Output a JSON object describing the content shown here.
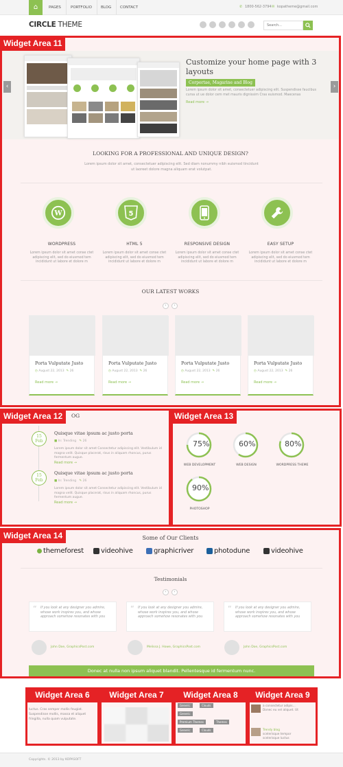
{
  "nav": {
    "items": [
      "PAGES",
      "PORTFOLIO",
      "BLOG",
      "CONTACT"
    ],
    "phone": "1800-562-3794",
    "email": "kopatheme@gmail.com"
  },
  "logo": {
    "bold": "CIRCLE",
    "light": "THEME"
  },
  "search": {
    "placeholder": "Search..."
  },
  "widget_areas": {
    "wa11": "Widget Area 11",
    "wa12": "Widget Area 12",
    "wa13": "Widget Area 13",
    "wa14": "Widget Area 14",
    "wa6": "Widget Area 6",
    "wa7": "Widget Area 7",
    "wa8": "Widget Area 8",
    "wa9": "Widget Area 9"
  },
  "slider": {
    "title": "Customize your home page with 3 layouts",
    "highlight": "Corportae, Magarine and Blog",
    "text": "Lorem ipsum dolor sit amet, consectetuer adipiscing elit. Suspendisse faucibus cursa ut ue dolor cem met mauris dignissim Cras euismod. Maecenas",
    "more": "Read more →"
  },
  "intro": {
    "title": "LOOKING FOR A PROFESSIONAL AND UNIQUE DESIGN?",
    "text": "Lorem ipsum dolor sit amet, consectetuer adipiscing elit. Sed diam nonummy nibh euismod tincidunt ut laoreet dolore magna aliquam erat volutpat."
  },
  "features": [
    {
      "title": "WORDPRESS",
      "icon": "wordpress-icon",
      "text": "Lorem ipsum dolor sit amet conse ctet adipiscing elit, sed do eiusmod tem incididunt ut labore et dolore m"
    },
    {
      "title": "HTML 5",
      "icon": "html5-icon",
      "text": "Lorem ipsum dolor sit amet conse ctet adipiscing elit, sed do eiusmod tem incididunt ut labore et dolore m"
    },
    {
      "title": "RESPONSIVE DESIGN",
      "icon": "mobile-icon",
      "text": "Lorem ipsum dolor sit amet conse ctet adipiscing elit, sed do eiusmod tem incididunt ut labore et dolore m"
    },
    {
      "title": "EASY SETUP",
      "icon": "wrench-icon",
      "text": "Lorem ipsum dolor sit amet conse ctet adipiscing elit, sed do eiusmod tem incididunt ut labore et dolore m"
    }
  ],
  "works": {
    "title": "OUR LATEST WORKS",
    "items": [
      {
        "title": "Porta Vulputate Justo",
        "date": "August 22, 2013",
        "comments": "26",
        "more": "Read more →"
      },
      {
        "title": "Porta Vulputate Justo",
        "date": "August 22, 2013",
        "comments": "26",
        "more": "Read more →"
      },
      {
        "title": "Porta Vulputate Justo",
        "date": "August 22, 2013",
        "comments": "26",
        "more": "Read more →"
      },
      {
        "title": "Porta Vulputate Justo",
        "date": "August 22, 2013",
        "comments": "26",
        "more": "Read more →"
      }
    ]
  },
  "blog": {
    "heading_tail": "OG",
    "posts": [
      {
        "day": "15",
        "month": "Feb",
        "title": "Quisque vitae ipsum ac justo porta",
        "category": "In: Trending",
        "comments": "26",
        "text": "Lorem ipsum dolor sit amet Consectetur adipiscing elit. Vestibulum id magna velit. Quisque placerat, risus in aliquam rhoncus, purus fermentum augue.",
        "more": "Read more →"
      },
      {
        "day": "15",
        "month": "Feb",
        "title": "Quisque vitae ipsum ac justo porta",
        "category": "In: Trending",
        "comments": "26",
        "text": "Lorem ipsum dolor sit amet Consectetur adipiscing elit. Vestibulum id magna velit. Quisque placerat, risus in aliquam rhoncus, purus fermentum augue.",
        "more": "Read more →"
      }
    ]
  },
  "skills": [
    {
      "value": "75%",
      "percent": 75,
      "label": "WEB DEVELOPMENT"
    },
    {
      "value": "60%",
      "percent": 60,
      "label": "WEB DESIGN"
    },
    {
      "value": "80%",
      "percent": 80,
      "label": "WORDPRESS THEME"
    },
    {
      "value": "90%",
      "percent": 90,
      "label": "PHOTOSHOP"
    }
  ],
  "clients": {
    "title": "Some of Our Clients",
    "names": [
      "themeforest",
      "videohive",
      "graphicriver",
      "photodune",
      "videohive"
    ]
  },
  "testimonials": {
    "title": "Testimonials",
    "items": [
      {
        "quote": "If you look at any designer you admire, whose work inspires you, and whose approach somehow resonates with you",
        "name": "John Doe, GraphicsPost.com"
      },
      {
        "quote": "If you look at any designer you admire, whose work inspires you, and whose approach somehow resonates with you",
        "name": "Melissa J. Howe, GraphicsPost.com"
      },
      {
        "quote": "If you look at any designer you admire, whose work inspires you, and whose approach somehow resonates with you",
        "name": "John Doe, GraphicsPost.com"
      }
    ]
  },
  "banner": {
    "text": "Donec at nulla non ipsum aliquet blandit. Pellentesque id fermentum nunc."
  },
  "footer_widgets": {
    "wa6_text": "luctus. Cras semper mollis feugiat. Suspendisse mollis, massa et aliquet fringilla, nulla quam vulputate.",
    "tags": [
      "Generic",
      "Clouds",
      "Generic",
      "Premium Themes",
      "Themes",
      "Generic",
      "Clouds"
    ],
    "wa9_links": [
      "a consectetur adipis…",
      "Donec eu vel aliquet. Ut",
      "Trendy blog",
      "scelerisque tempor",
      "scelerisque luctus"
    ]
  },
  "copyright": "Copyrights. © 2013 by KOPASOFT",
  "colors": {
    "accent": "#8dc152",
    "widget_red": "#e52225"
  }
}
